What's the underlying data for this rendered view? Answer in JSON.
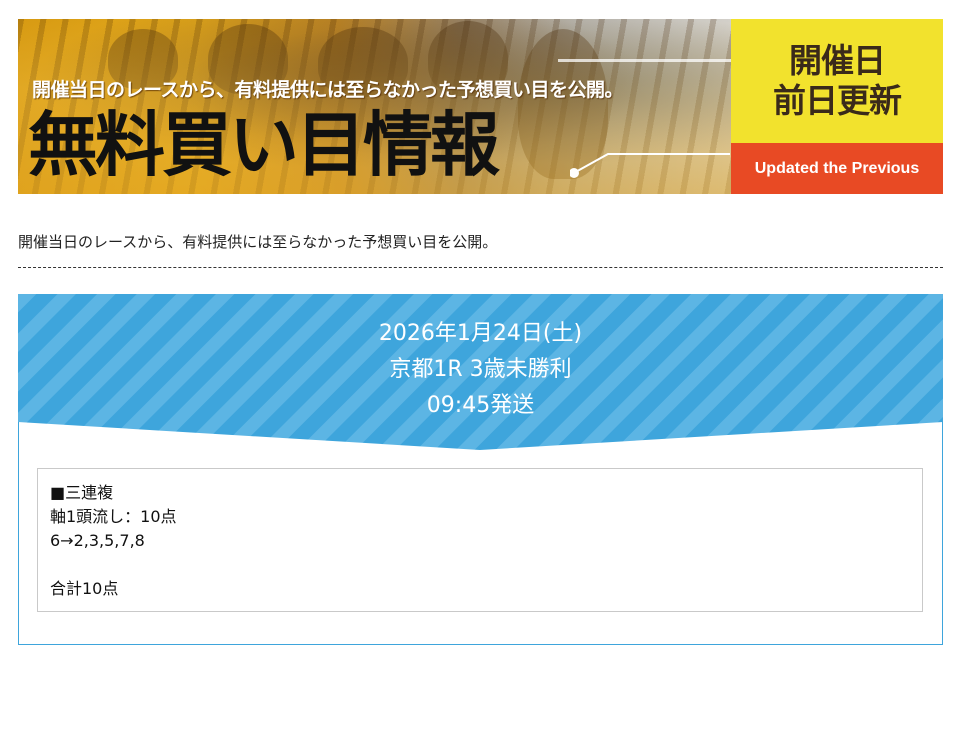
{
  "banner": {
    "subtitle": "開催当日のレースから、有料提供には至らなかった予想買い目を公開。",
    "title": "無料買い目情報",
    "badge_line1": "開催日",
    "badge_line2": "前日更新",
    "badge_english": "Updated the Previous",
    "colors": {
      "badge_yellow": "#f2e22d",
      "badge_red": "#e84a24"
    }
  },
  "intro": {
    "text": "開催当日のレースから、有料提供には至らなかった予想買い目を公開。"
  },
  "race": {
    "date": "2026年1月24日(土)",
    "race_name": "京都1R 3歳未勝利",
    "post_time": "09:45発送",
    "header_color": "#3ea5dc"
  },
  "bet": {
    "type": "■三連複",
    "method": "軸1頭流し：10点",
    "combination": "6→2,3,5,7,8",
    "total": "合計10点"
  }
}
